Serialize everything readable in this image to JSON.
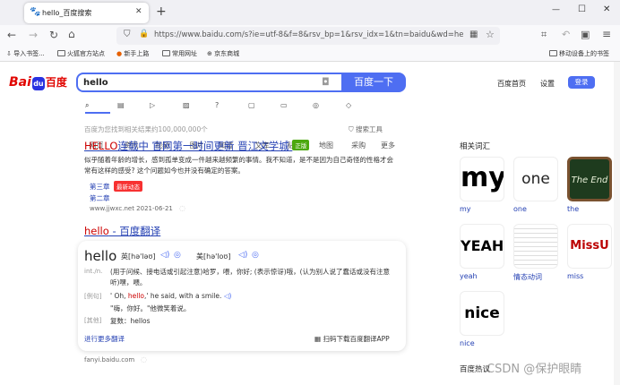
{
  "browser": {
    "tab_title": "hello_百度搜索",
    "new_tab": "+",
    "url": "https://www.baidu.com/s?ie=utf-8&f=8&rsv_bp=1&rsv_idx=1&tn=baidu&wd=hello",
    "bookmarks": [
      "导入书签...",
      "火狐官方站点",
      "新手上路",
      "常用网址",
      "京东商城"
    ],
    "mobile_bookmarks": "移动设备上的书签",
    "controls": {
      "minimize": "—",
      "maximize": "☐",
      "close": "✕"
    }
  },
  "baidu": {
    "logo_text": "Bai",
    "logo_text2": "百度",
    "query": "hello",
    "search_button": "百度一下",
    "top_links": [
      "百度首页",
      "设置"
    ],
    "login": "登录",
    "tabs": [
      "网页",
      "资讯",
      "视频",
      "图片",
      "知道",
      "文库",
      "贴吧",
      "地图",
      "采购",
      "更多"
    ],
    "result_count": "百度为您找到相关结果约100,000,000个",
    "search_tools": "搜索工具",
    "results": [
      {
        "title_highlight": "HELLO",
        "title_rest": "连载中 官网第一时间更新 晋江文学城",
        "badge": "正版",
        "snippet": "似乎随着年龄的增长，感到孤单变成一件越来越频繁的事情。我不知道，是不是因为自己奇怪的性格才会常有这样的感受? 这个问题如今也并没有确定的答案。",
        "chapter1": "第三章",
        "chapter1_badge": "最新动态",
        "chapter2": "第二章",
        "source": "www.jjwxc.net 2021-06-21"
      },
      {
        "title_highlight": "hello",
        "title_rest": " - 百度翻译"
      }
    ],
    "translate": {
      "word": "hello",
      "uk": "英[hə'ləʊ]",
      "us": "美[hə'loʊ]",
      "pos": "int./n.",
      "def": "(用于问候、接电话或引起注意)哈罗，喂，你好; (表示惊讶)哦，(认为别人说了蠢话或没有注意听)嘿，喂。",
      "example_label": "[例句]",
      "example_en_before": "' Oh, ",
      "example_en_hl": "hello",
      "example_en_after": ",' he said, with a smile.",
      "example_cn": "\"嗨，你好。\"他微笑着说。",
      "other_label": "[其他]",
      "other": "复数：hellos",
      "more": "进行更多翻译",
      "app": "扫码下载百度翻译APP",
      "source": "fanyi.baidu.com"
    },
    "related_title": "相关词汇",
    "related": [
      {
        "label": "my",
        "img_text": "my"
      },
      {
        "label": "one",
        "img_text": "one"
      },
      {
        "label": "the",
        "img_text": "The End"
      },
      {
        "label": "yeah",
        "img_text": "YEAH"
      },
      {
        "label": "情态动词",
        "img_text": ""
      },
      {
        "label": "miss",
        "img_text": "MissU"
      },
      {
        "label": "nice",
        "img_text": "nice"
      }
    ],
    "bottom_label": "百度热议",
    "watermark": "CSDN @保护眼睛"
  },
  "colors": {
    "accent": "#4e6ef2",
    "link": "#2440b3",
    "red": "#c00",
    "green_badge": "#4ca80e",
    "red_badge": "#f73131"
  }
}
